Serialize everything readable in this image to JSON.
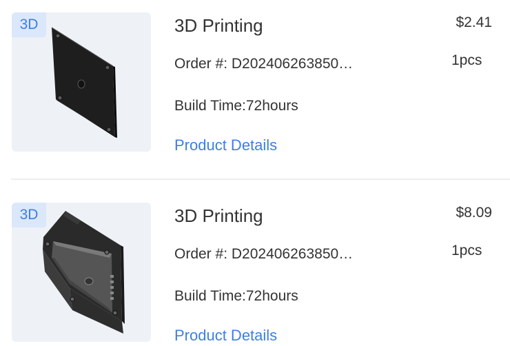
{
  "items": [
    {
      "badge": "3D",
      "thumbnail_icon": "square-plate-part",
      "title": "3D Printing",
      "order": "Order #: D202406263850…",
      "build_time": "Build Time:72hours",
      "details_link": "Product Details",
      "price": "$2.41",
      "quantity": "1pcs"
    },
    {
      "badge": "3D",
      "thumbnail_icon": "enclosure-box-part",
      "title": "3D Printing",
      "order": "Order #: D202406263850…",
      "build_time": "Build Time:72hours",
      "details_link": "Product Details",
      "price": "$8.09",
      "quantity": "1pcs"
    }
  ],
  "colors": {
    "link": "#3d7fe1",
    "badge_bg": "#dbe7fb",
    "thumb_bg": "#eef1f6",
    "text": "#333333",
    "divider": "#eeeeee"
  }
}
